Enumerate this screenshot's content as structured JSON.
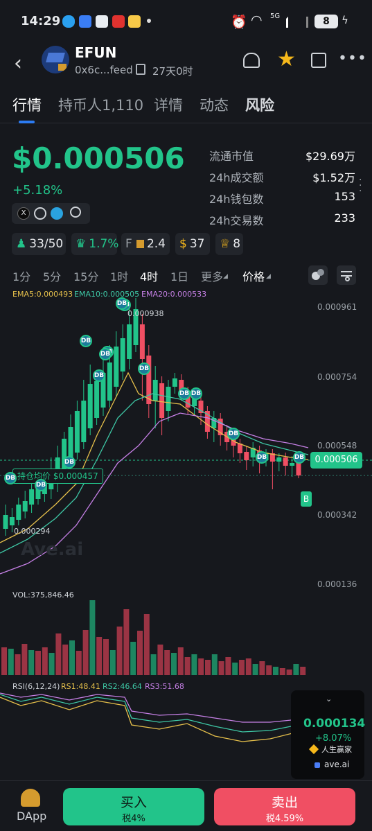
{
  "status": {
    "time": "14:29",
    "battery": "8",
    "net_label": "5G"
  },
  "token": {
    "name": "EFUN",
    "address": "0x6c...feed",
    "age": "27天0时"
  },
  "tabs": [
    {
      "label": "行情"
    },
    {
      "label": "持币人1,110"
    },
    {
      "label": "详情"
    },
    {
      "label": "动态"
    },
    {
      "label": "风险"
    }
  ],
  "price": {
    "value": "$0.000506",
    "change": "+5.18%"
  },
  "stats": [
    {
      "label": "流通市值",
      "value": "$29.69万"
    },
    {
      "label": "24h成交额",
      "value": "$1.52万"
    },
    {
      "label": "24h钱包数",
      "value": "153"
    },
    {
      "label": "24h交易数",
      "value": "233"
    }
  ],
  "pills": {
    "holders": "33/50",
    "percent": "1.7%",
    "f_label": "F",
    "f_value": "2.4",
    "bag": "37",
    "trophy": "8"
  },
  "timeframes": [
    "1分",
    "5分",
    "15分",
    "1时",
    "4时",
    "1日",
    "更多",
    "价格"
  ],
  "active_timeframe": "4时",
  "ema": {
    "ema5": "EMA5:0.000493",
    "ema10": "EMA10:0.000505",
    "ema20": "EMA20:0.000533"
  },
  "chart_data": {
    "type": "candlestick",
    "y_ticks": [
      "0.000961",
      "0.000754",
      "0.000548",
      "0.000342",
      "0.000136"
    ],
    "current_price_tag": "0.000506",
    "high_label": "0.000938",
    "low_label": "0.000294",
    "avg_cost_label": "持仓均价 $0.000457",
    "watermark": "Ave.ai",
    "marker_labels": {
      "db": "DB",
      "buy": "B"
    }
  },
  "volume": {
    "label": "VOL:375,846.46"
  },
  "rsi": {
    "title": "RSI(6,12,24)",
    "rs1": "RS1:48.41",
    "rs2": "RS2:46.64",
    "rs3": "RS3:51.68"
  },
  "overlay": {
    "price": "0.000134",
    "change": "+8.07%",
    "token": "人生赢家",
    "site": "ave.ai"
  },
  "bottom": {
    "dapp": "DApp",
    "buy_label": "买入",
    "buy_tax": "税4%",
    "sell_label": "卖出",
    "sell_tax": "税4.59%"
  },
  "colors": {
    "green": "#22c48a",
    "red": "#f04f63",
    "ema5": "#e6c04b",
    "ema10": "#3ec8a6",
    "ema20": "#c680e6"
  }
}
